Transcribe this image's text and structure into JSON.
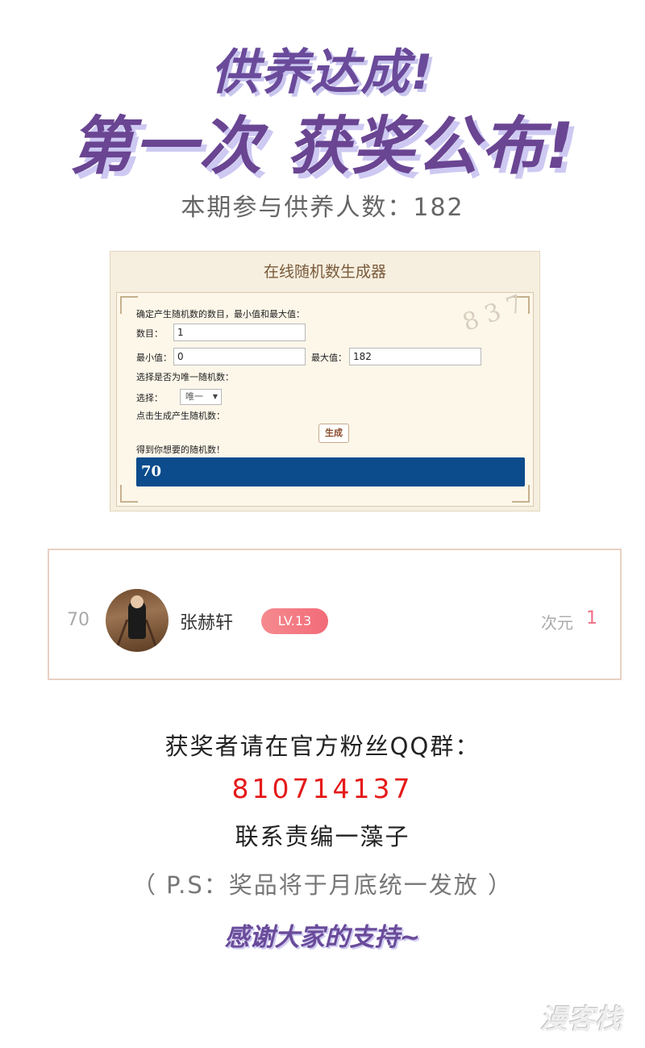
{
  "header": {
    "title_line1": "供养达成!",
    "title_line2_part1": "第一次",
    "title_line2_part2": "获奖公布!",
    "participants": "本期参与供养人数：182"
  },
  "generator": {
    "title": "在线随机数生成器",
    "instruction": "确定产生随机数的数目，最小值和最大值：",
    "count_label": "数目：",
    "count_value": "1",
    "min_label": "最小值：",
    "min_value": "0",
    "max_label": "最大值：",
    "max_value": "182",
    "unique_prompt": "选择是否为唯一随机数：",
    "select_label": "选择：",
    "select_value": "唯一",
    "click_prompt": "点击生成产生随机数：",
    "button_label": "生成",
    "result_prompt": "得到你想要的随机数！",
    "result_value": "70"
  },
  "winner": {
    "rank": "70",
    "name": "张赫轩",
    "level": "LV.13",
    "dimension_label": "次元",
    "dimension_value": "1"
  },
  "contact": {
    "line1": "获奖者请在官方粉丝QQ群：",
    "qq_number": "810714137",
    "line3": "联系责编一藻子",
    "note": "（ P.S：奖品将于月底统一发放 ）",
    "thanks": "感谢大家的支持~"
  },
  "watermark": "漫客栈",
  "colors": {
    "title_purple": "#6a4592",
    "qq_red": "#e51a1a",
    "result_blue": "#0c4c8c",
    "level_pink": "#f26b78"
  }
}
